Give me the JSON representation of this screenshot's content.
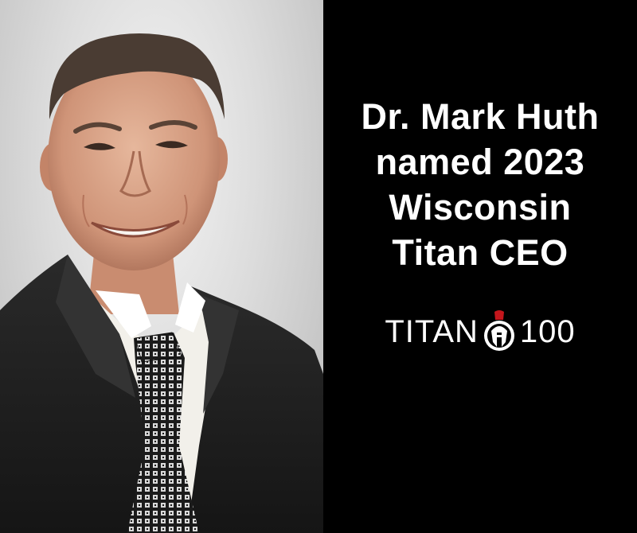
{
  "headline": {
    "line1": "Dr. Mark Huth",
    "line2": "named 2023",
    "line3": "Wisconsin",
    "line4": "Titan CEO"
  },
  "logo": {
    "left_text": "TITAN",
    "right_text": "100",
    "icon": "helmet-icon",
    "accent_color": "#c4161c"
  },
  "colors": {
    "panel_background": "#000000",
    "headline_text": "#ffffff"
  }
}
